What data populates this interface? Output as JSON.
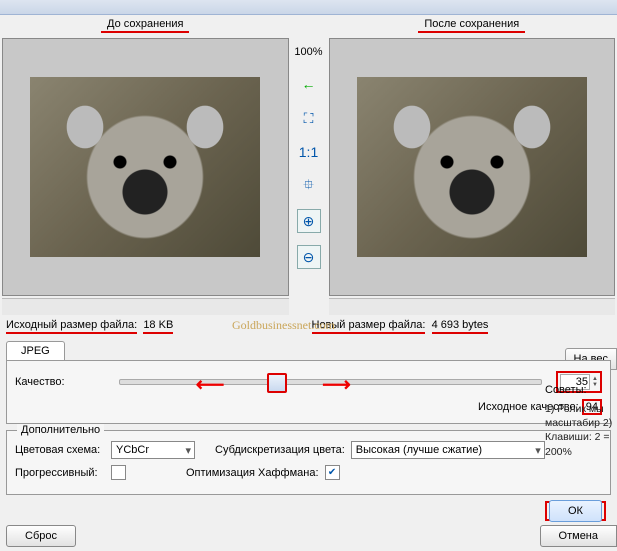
{
  "zoom": "100%",
  "headers": {
    "before": "До сохранения",
    "after": "После сохранения"
  },
  "tools": {
    "arrow": "←",
    "fit": "⛶",
    "one": "1:1",
    "fit2": "⯐",
    "zin": "⊕",
    "zout": "⊖"
  },
  "size": {
    "orig_label": "Исходный размер файла:",
    "orig_value": "18 KB",
    "new_label": "Новый размер файла:",
    "new_value": "4 693 bytes"
  },
  "watermark": "Goldbusinessnet.com",
  "tab": "JPEG",
  "side_btn": "На вес",
  "quality": {
    "label": "Качество:",
    "value": "35",
    "src_label": "Исходное качество:",
    "src_value": "94"
  },
  "extra": {
    "group": "Дополнительно",
    "color_label": "Цветовая схема:",
    "color_value": "YCbCr",
    "sub_label": "Субдискретизация цвета:",
    "sub_value": "Высокая (лучше сжатие)",
    "prog_label": "Прогрессивный:",
    "prog_checked": false,
    "huff_label": "Оптимизация Хаффмана:",
    "huff_checked": true
  },
  "tips": {
    "title": "Советы:",
    "body": "1) Ролик мы масштабир\n2) Клавиши: 2 = 200%"
  },
  "buttons": {
    "reset": "Сброс",
    "ok": "ОК",
    "cancel": "Отмена"
  }
}
